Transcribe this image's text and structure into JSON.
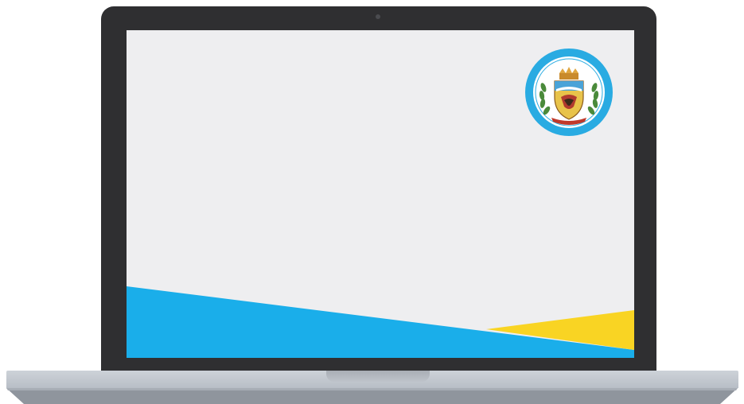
{
  "laptop": {
    "bezel_color": "#2f2f31",
    "screen_background": "#eeeef0",
    "base_color": "#c3c8cf"
  },
  "screen": {
    "band_colors": {
      "blue": "#1aaeea",
      "yellow": "#f9d423"
    },
    "seal": {
      "ring_color": "#29abe2",
      "arc_text": "MUNICIPIO DE LOGAN"
    }
  }
}
